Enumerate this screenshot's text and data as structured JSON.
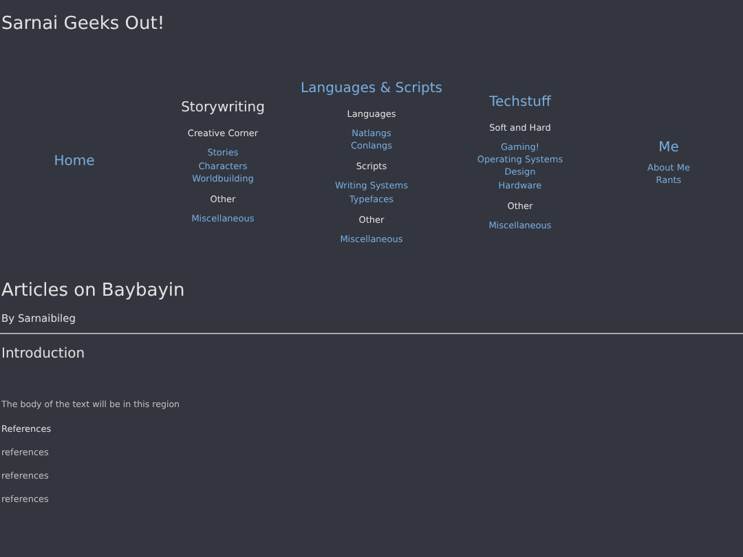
{
  "site_title": "Sarnai Geeks Out!",
  "nav": [
    {
      "title": "Home"
    },
    {
      "title": "Storywriting",
      "sections": [
        {
          "heading": "Creative Corner",
          "links": [
            "Stories",
            "Characters",
            "Worldbuilding"
          ]
        },
        {
          "heading": "Other",
          "links": [
            "Miscellaneous"
          ]
        }
      ]
    },
    {
      "title": "Languages & Scripts",
      "sections": [
        {
          "heading": "Languages",
          "links": [
            "Natlangs",
            "Conlangs"
          ]
        },
        {
          "heading": "Scripts",
          "links": [
            "Writing Systems",
            "Typefaces"
          ]
        },
        {
          "heading": "Other",
          "links": [
            "Miscellaneous"
          ]
        }
      ]
    },
    {
      "title": "Techstuff",
      "sections": [
        {
          "heading": "Soft and Hard",
          "links": [
            "Gaming!",
            "Operating Systems",
            "Design",
            "Hardware"
          ]
        },
        {
          "heading": "Other",
          "links": [
            "Miscellaneous"
          ]
        }
      ]
    },
    {
      "title": "Me",
      "sections": [
        {
          "links": [
            "About Me",
            "Rants"
          ]
        }
      ]
    }
  ],
  "article": {
    "title": "Articles on Baybayin",
    "byline": "By Sarnaibileg",
    "section_title": "Introduction",
    "body": "The body of the text will be in this region",
    "references_heading": "References",
    "references": [
      "references",
      "references",
      "references"
    ]
  }
}
